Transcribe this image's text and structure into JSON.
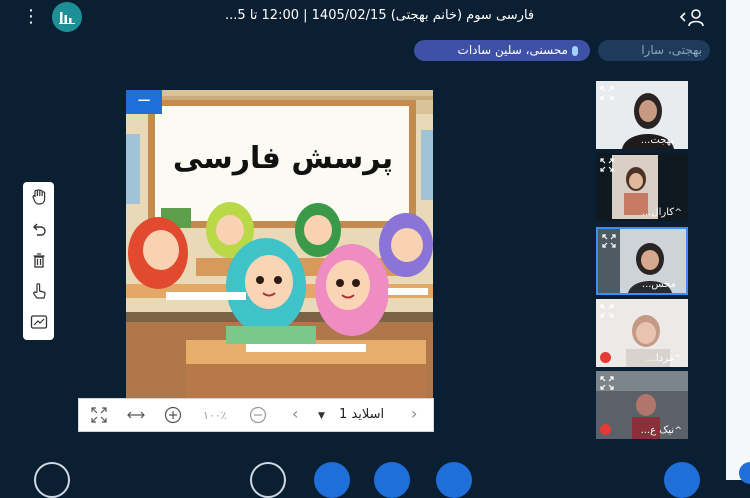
{
  "header": {
    "title": "فارسی سوم (خانم بهجتی) 1405/02/15 | 12:00 تا 5...",
    "menu_icon": "kebab-menu-icon",
    "app_icon": "bar-chart-icon",
    "user_icon": "user-icon"
  },
  "speakers": {
    "active": "محسنی، سلین سادات",
    "other": "بهجتی، سارا"
  },
  "slide": {
    "heading": "پرسش فارسی"
  },
  "slide_toolbar": {
    "slide_label": "اسلاید 1",
    "zoom": "۱۰۰٪"
  },
  "participants": [
    {
      "name": "بهجت...",
      "muted": false
    },
    {
      "name": "کارال...",
      "muted": false
    },
    {
      "name": "محس...",
      "muted": false
    },
    {
      "name": "مردا...",
      "muted": true
    },
    {
      "name": "نیک ع...",
      "muted": true
    }
  ],
  "colors": {
    "background": "#0b1f33",
    "accent": "#1e6fd9",
    "chip": "#3f51a6",
    "teal": "#1d8f97",
    "mute": "#e53935"
  }
}
